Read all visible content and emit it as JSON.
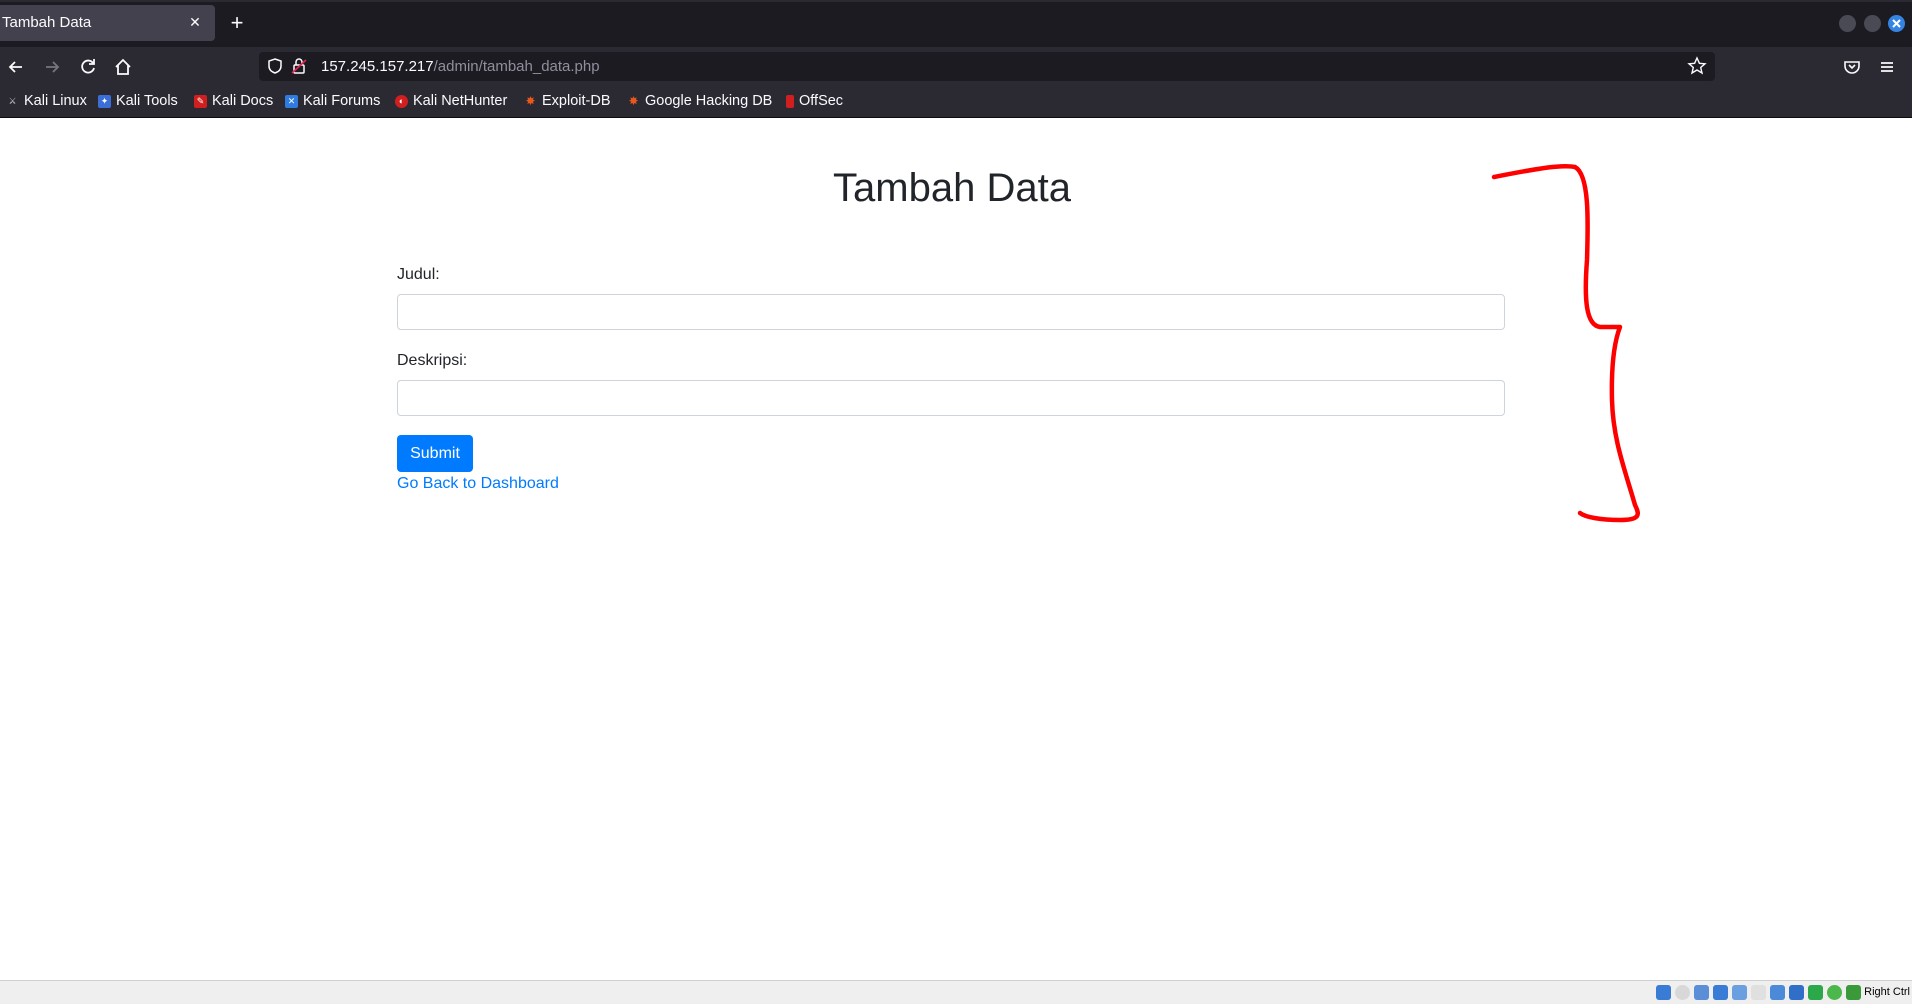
{
  "browser": {
    "tab": {
      "title": "Tambah Data",
      "close_glyph": "✕"
    },
    "new_tab_glyph": "+",
    "url": {
      "host": "157.245.157.217",
      "path": "/admin/tambah_data.php"
    },
    "icons": {
      "back": "arrow-left-icon",
      "forward": "arrow-right-icon",
      "reload": "reload-icon",
      "home": "home-icon",
      "shield": "shield-icon",
      "lock": "insecure-lock-icon",
      "star": "star-icon",
      "pocket": "pocket-icon",
      "menu": "hamburger-menu-icon"
    },
    "bookmarks": [
      {
        "label": "Kali Linux",
        "color": "#2b2a33"
      },
      {
        "label": "Kali Tools",
        "color": "#3a6fd8"
      },
      {
        "label": "Kali Docs",
        "color": "#d11f1f"
      },
      {
        "label": "Kali Forums",
        "color": "#2f7be0"
      },
      {
        "label": "Kali NetHunter",
        "color": "#d11f1f"
      },
      {
        "label": "Exploit-DB",
        "color": "#e8581c"
      },
      {
        "label": "Google Hacking DB",
        "color": "#e8581c"
      },
      {
        "label": "OffSec",
        "color": "#d11f1f"
      }
    ]
  },
  "page": {
    "title": "Tambah Data",
    "fields": [
      {
        "label": "Judul:",
        "value": "",
        "placeholder": ""
      },
      {
        "label": "Deskripsi:",
        "value": "",
        "placeholder": ""
      }
    ],
    "submit_label": "Submit",
    "back_link": "Go Back to Dashboard"
  },
  "annotation": {
    "shape": "right-curly-brace",
    "color": "#ff0000"
  },
  "vm_status": {
    "host_key": "Right Ctrl"
  },
  "colors": {
    "chrome_dark": "#1c1b22",
    "chrome": "#2b2a33",
    "primary": "#007bff",
    "text": "#212529"
  }
}
